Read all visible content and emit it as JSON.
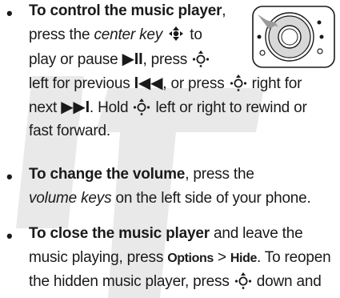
{
  "watermark": {
    "text": "DRAFT",
    "color": "#e4e4e4"
  },
  "bullets": [
    {
      "lines": [
        [
          {
            "t": "To control the music player",
            "b": true
          },
          {
            "t": ","
          }
        ],
        [
          {
            "t": "press the "
          },
          {
            "t": "center key",
            "i": true
          },
          {
            "t": " "
          },
          {
            "icon": "center-key-icon"
          },
          {
            "t": " to"
          }
        ],
        [
          {
            "t": "play or pause "
          },
          {
            "sym": "▶II"
          },
          {
            "t": ", press "
          },
          {
            "icon": "nav-key-icon"
          }
        ],
        [
          {
            "t": "left for previous "
          },
          {
            "sym": "I◀◀"
          },
          {
            "t": ", or press "
          },
          {
            "icon": "nav-key-icon"
          },
          {
            "t": " right for"
          }
        ],
        [
          {
            "t": "next "
          },
          {
            "sym": "▶▶I"
          },
          {
            "t": ". Hold "
          },
          {
            "icon": "nav-key-icon"
          },
          {
            "t": " left or right to rewind or"
          }
        ],
        [
          {
            "t": "fast forward."
          }
        ]
      ]
    },
    {
      "lines": [
        [
          {
            "t": "To change the volume",
            "b": true
          },
          {
            "t": ", press the"
          }
        ],
        [
          {
            "t": "volume keys",
            "i": true
          },
          {
            "t": " on the left side of your phone."
          }
        ]
      ]
    },
    {
      "lines": [
        [
          {
            "t": "To close the music player",
            "b": true
          },
          {
            "t": " and leave the"
          }
        ],
        [
          {
            "t": "music playing, press "
          },
          {
            "key": "Options"
          },
          {
            "t": " > "
          },
          {
            "key": "Hide"
          },
          {
            "t": ". To reopen"
          }
        ],
        [
          {
            "t": "the hidden music player, press "
          },
          {
            "icon": "nav-key-icon"
          },
          {
            "t": " down and"
          }
        ]
      ]
    }
  ],
  "colors": {
    "text": "#1a1a1a",
    "illustration_gray": "#d6d6d6",
    "arrow_gray": "#9a9a9a"
  }
}
